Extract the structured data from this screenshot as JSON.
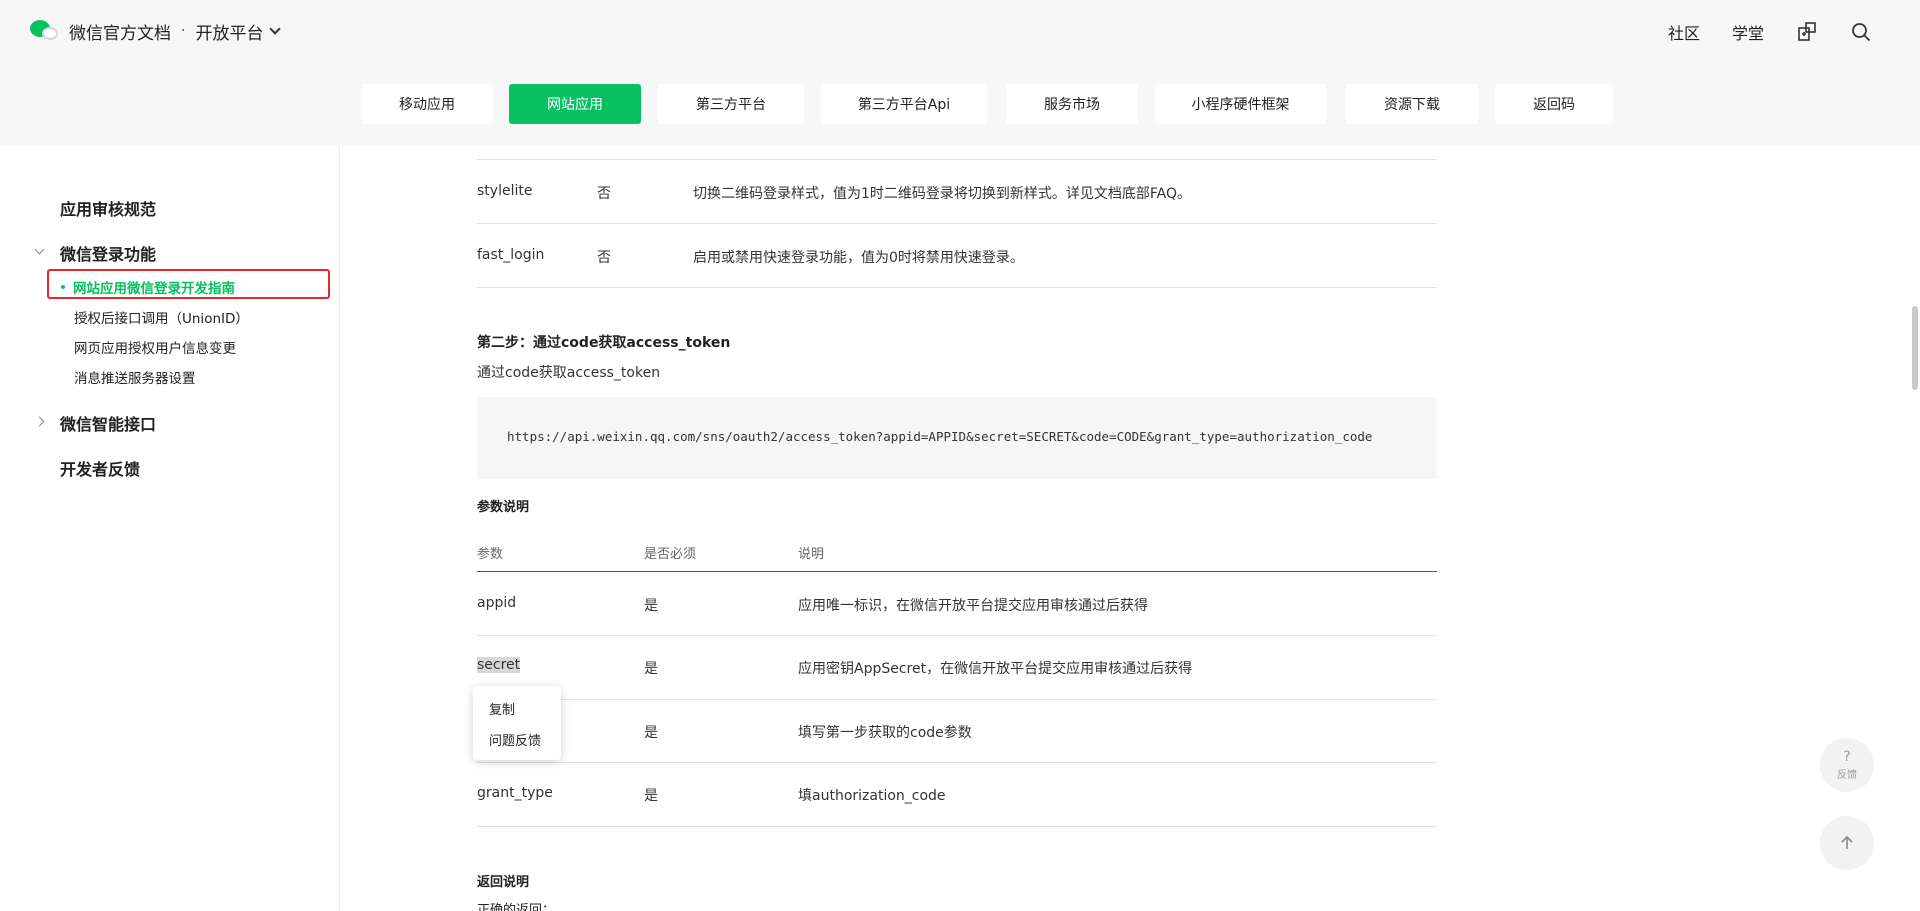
{
  "header": {
    "brand_title": "微信官方文档",
    "separator": "·",
    "platform": "开放平台",
    "links": [
      "社区",
      "学堂"
    ],
    "icons": [
      "extension-icon",
      "search-icon"
    ]
  },
  "tabs": [
    {
      "label": "移动应用",
      "active": false
    },
    {
      "label": "网站应用",
      "active": true
    },
    {
      "label": "第三方平台",
      "active": false
    },
    {
      "label": "第三方平台Api",
      "active": false
    },
    {
      "label": "服务市场",
      "active": false
    },
    {
      "label": "小程序硬件框架",
      "active": false
    },
    {
      "label": "资源下载",
      "active": false
    },
    {
      "label": "返回码",
      "active": false
    }
  ],
  "sidebar": {
    "review": "应用审核规范",
    "login_group": "微信登录功能",
    "active_item": "网站应用微信登录开发指南",
    "items": [
      "授权后接口调用（UnionID）",
      "网页应用授权用户信息变更",
      "消息推送服务器设置"
    ],
    "smart_group": "微信智能接口",
    "feedback": "开发者反馈"
  },
  "prev_table": [
    {
      "param": "stylelite",
      "required": "否",
      "desc": "切换二维码登录样式，值为1时二维码登录将切换到新样式。详见文档底部FAQ。"
    },
    {
      "param": "fast_login",
      "required": "否",
      "desc": "启用或禁用快速登录功能，值为0时将禁用快速登录。"
    }
  ],
  "step2": {
    "title": "第二步：通过code获取access_token",
    "subtitle": "通过code获取access_token",
    "code": "https://api.weixin.qq.com/sns/oauth2/access_token?appid=APPID&secret=SECRET&code=CODE&grant_type=authorization_code"
  },
  "params_section": {
    "title": "参数说明",
    "headers": [
      "参数",
      "是否必须",
      "说明"
    ],
    "rows": [
      {
        "param": "appid",
        "required": "是",
        "desc": "应用唯一标识，在微信开放平台提交应用审核通过后获得"
      },
      {
        "param": "secret",
        "required": "是",
        "desc": "应用密钥AppSecret，在微信开放平台提交应用审核通过后获得"
      },
      {
        "param": "",
        "required": "是",
        "desc": "填写第一步获取的code参数"
      },
      {
        "param": "grant_type",
        "required": "是",
        "desc": "填authorization_code"
      }
    ]
  },
  "return_section": {
    "title": "返回说明",
    "partial": "正确的返回："
  },
  "context_menu": {
    "items": [
      "复制",
      "问题反馈"
    ]
  },
  "float": {
    "feedback_symbol": "?",
    "feedback_label": "反馈",
    "top_icon": "arrow-up-icon"
  }
}
